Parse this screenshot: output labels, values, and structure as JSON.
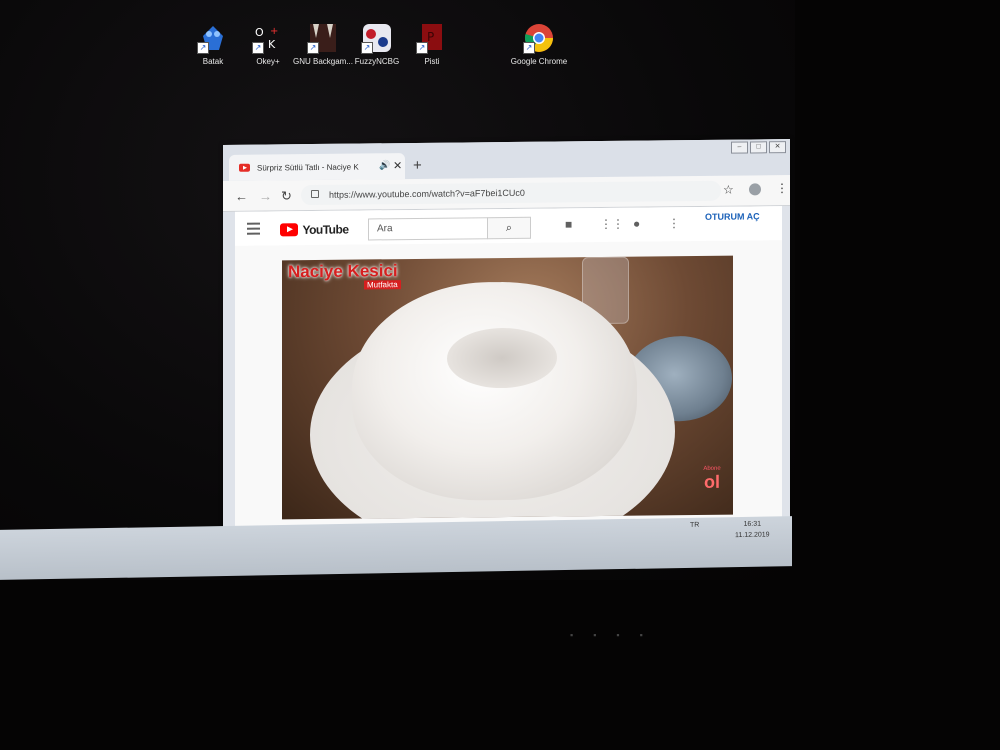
{
  "desktop": {
    "icons": [
      {
        "label": "Batak",
        "icon": "batak-icon"
      },
      {
        "label": "Okey+",
        "icon": "okey-icon"
      },
      {
        "label": "GNU Backgam...",
        "icon": "backgammon-icon"
      },
      {
        "label": "FuzzyNCBG",
        "icon": "fuzzy-icon"
      },
      {
        "label": "Pisti",
        "icon": "pisti-icon"
      },
      {
        "label": "Google Chrome",
        "icon": "chrome-icon"
      }
    ]
  },
  "browser": {
    "tab_title": "Sürpriz Sütlü Tatlı - Naciye K",
    "url": "https://www.youtube.com/watch?v=aF7bei1CUc0"
  },
  "youtube": {
    "logo_text": "YouTube",
    "search_placeholder": "Ara",
    "signin_label": "OTURUM AÇ"
  },
  "video": {
    "overlay_title": "Naciye Kesici",
    "overlay_subtitle": "Mutfakta",
    "badge_small": "Abone",
    "badge_big": "ol"
  },
  "taskbar": {
    "tray_lang": "TR",
    "time": "16:31",
    "date": "11.12.2019"
  },
  "colors": {
    "youtube_red": "#ff0000",
    "link_blue": "#1c62b9"
  }
}
